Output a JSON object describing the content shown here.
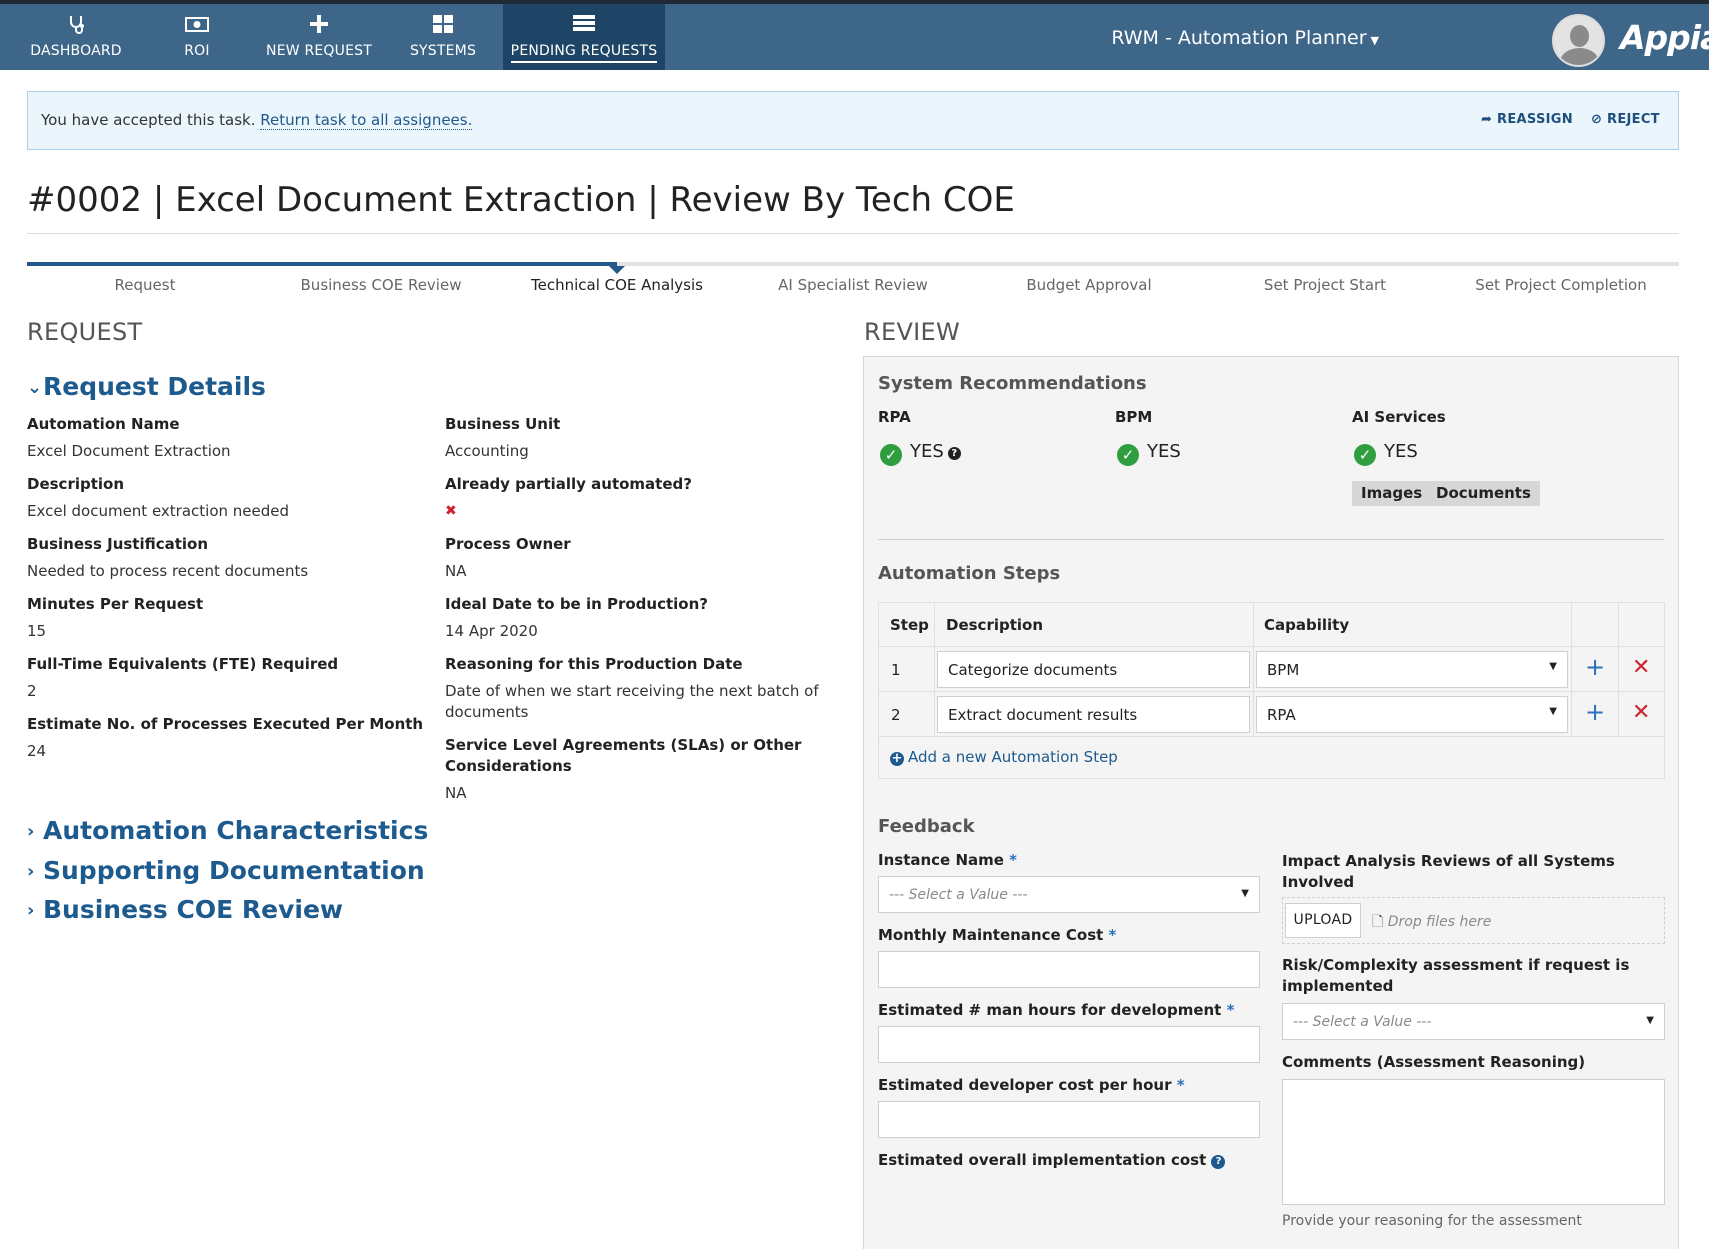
{
  "nav": {
    "items": [
      {
        "label": "DASHBOARD",
        "icon": "stethoscope-icon"
      },
      {
        "label": "ROI",
        "icon": "money-icon"
      },
      {
        "label": "NEW REQUEST",
        "icon": "plus-icon"
      },
      {
        "label": "SYSTEMS",
        "icon": "grid-icon"
      },
      {
        "label": "PENDING REQUESTS",
        "icon": "list-icon"
      }
    ],
    "app_name": "RWM - Automation Planner",
    "logo": "Appian"
  },
  "banner": {
    "message": "You have accepted this task.",
    "return_link": "Return task to all assignees.",
    "reassign": "REASSIGN",
    "reject": "REJECT"
  },
  "title": "#0002 | Excel Document Extraction | Review By Tech COE",
  "progress": {
    "steps": [
      "Request",
      "Business COE Review",
      "Technical COE Analysis",
      "AI Specialist Review",
      "Budget Approval",
      "Set Project Start",
      "Set Project Completion"
    ],
    "current_index": 2
  },
  "request": {
    "heading": "REQUEST",
    "details_title": "Request Details",
    "left_fields": [
      {
        "label": "Automation Name",
        "value": "Excel Document Extraction"
      },
      {
        "label": "Description",
        "value": "Excel document extraction needed"
      },
      {
        "label": "Business Justification",
        "value": "Needed to process recent documents"
      },
      {
        "label": "Minutes Per Request",
        "value": "15"
      },
      {
        "label": "Full-Time Equivalents (FTE) Required",
        "value": "2"
      },
      {
        "label": "Estimate No. of Processes Executed Per Month",
        "value": "24"
      }
    ],
    "right_fields": [
      {
        "label": "Business Unit",
        "value": "Accounting"
      },
      {
        "label": "Already partially automated?",
        "value": "✖"
      },
      {
        "label": "Process Owner",
        "value": "NA"
      },
      {
        "label": "Ideal Date to be in Production?",
        "value": "14 Apr 2020"
      },
      {
        "label": "Reasoning for this Production Date",
        "value": "Date of when we start receiving the next batch of documents"
      },
      {
        "label": "Service Level Agreements (SLAs) or Other Considerations",
        "value": "NA"
      }
    ],
    "collapsed_sections": [
      "Automation Characteristics",
      "Supporting Documentation",
      "Business COE Review"
    ]
  },
  "review": {
    "heading": "REVIEW",
    "sys_title": "System Recommendations",
    "systems": [
      {
        "name": "RPA",
        "value": "YES"
      },
      {
        "name": "BPM",
        "value": "YES"
      },
      {
        "name": "AI Services",
        "value": "YES"
      }
    ],
    "ai_tags": [
      "Images",
      "Documents"
    ],
    "steps_title": "Automation Steps",
    "steps_cols": [
      "Step",
      "Description",
      "Capability"
    ],
    "steps_rows": [
      {
        "step": "1",
        "description": "Categorize documents",
        "capability": "BPM"
      },
      {
        "step": "2",
        "description": "Extract document results",
        "capability": "RPA"
      }
    ],
    "add_step": "Add a new Automation Step",
    "feedback_title": "Feedback",
    "fields": {
      "instance_name": "Instance Name",
      "select_placeholder": "--- Select a Value ---",
      "monthly_cost": "Monthly Maintenance Cost",
      "man_hours": "Estimated # man hours for development",
      "dev_cost": "Estimated developer cost per hour",
      "overall_cost": "Estimated overall implementation cost",
      "impact": "Impact Analysis Reviews of all Systems Involved",
      "upload": "UPLOAD",
      "drop": "Drop files here",
      "risk": "Risk/Complexity assessment if request is implemented",
      "comments": "Comments (Assessment Reasoning)",
      "comments_hint": "Provide your reasoning for the assessment"
    },
    "required_mark": "*"
  },
  "colors": {
    "nav_bg": "#3e6689",
    "accent": "#22588a",
    "success": "#2e9e3f",
    "danger": "#d0232d"
  }
}
